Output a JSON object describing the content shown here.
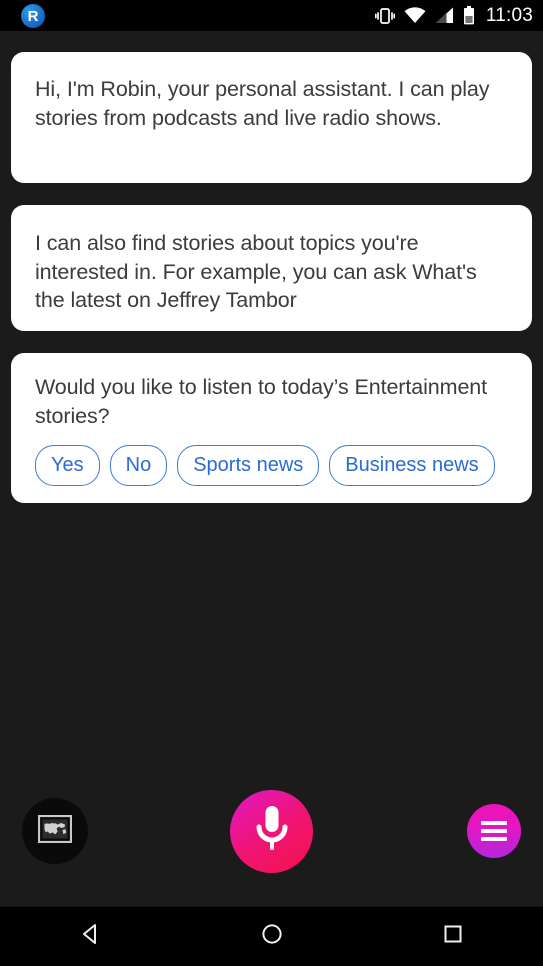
{
  "statusbar": {
    "app_icon_letter": "R",
    "app_icon_name": "robin-app-icon",
    "clock": "11:03",
    "icons": [
      "vibrate-icon",
      "wifi-icon",
      "cellular-signal-icon",
      "battery-icon"
    ]
  },
  "messages": [
    {
      "id": "card1",
      "text": "Hi, I'm Robin, your personal assistant. I can play stories from podcasts and live radio shows."
    },
    {
      "id": "card2",
      "text": "I can also find stories about topics you're interested in. For example, you can ask What's the latest on Jeffrey Tambor"
    },
    {
      "id": "card3",
      "text": "Would you like to listen to today’s Entertainment stories?",
      "chips": [
        "Yes",
        "No",
        "Sports news",
        "Business news"
      ]
    }
  ],
  "controls": {
    "world_button": "world-map-button",
    "mic_button": "microphone-button",
    "menu_button": "hamburger-menu-button"
  },
  "navbar": {
    "back": "back-nav-icon",
    "home": "home-nav-icon",
    "recents": "recents-nav-icon"
  },
  "colors": {
    "background": "#1b1b1b",
    "card": "#ffffff",
    "chip_accent": "#2a6bd4",
    "mic_gradient_start": "#e018c8",
    "mic_gradient_end": "#f5124a",
    "menu_gradient_start": "#ef12b8",
    "menu_gradient_end": "#b526dd",
    "app_icon_blue": "#1565c0"
  }
}
